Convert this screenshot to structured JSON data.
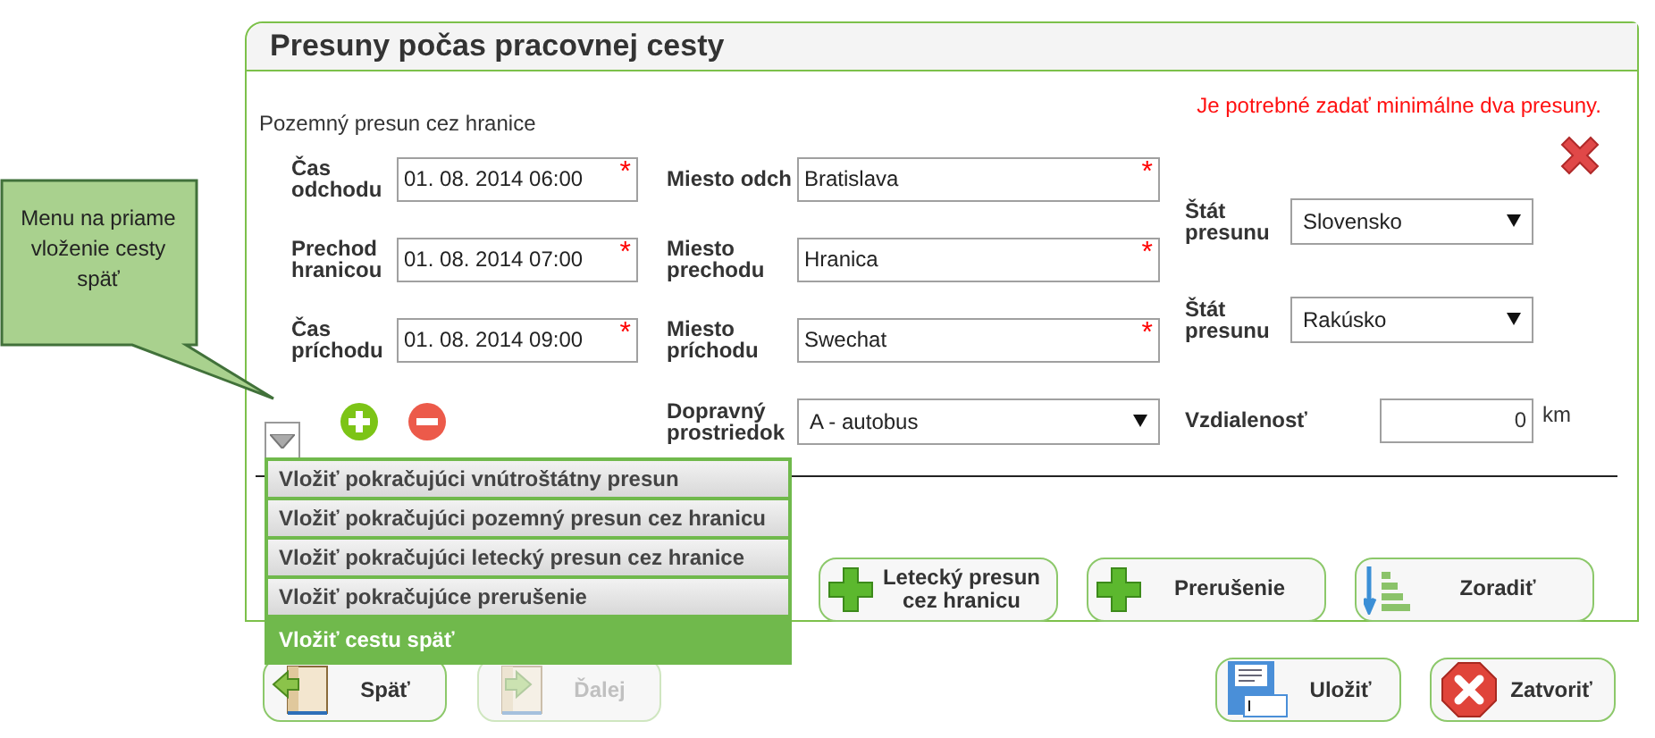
{
  "title": "Presuny počas pracovnej cesty",
  "error": "Je potrebné zadať minimálne dva presuny.",
  "section_label": "Pozemný presun cez hranice",
  "required_mark": "*",
  "times": [
    {
      "label": "Čas odchodu",
      "value": "01. 08. 2014 06:00",
      "required": true
    },
    {
      "label": "Prechod hranicou",
      "value": "01. 08. 2014 07:00",
      "required": true
    },
    {
      "label": "Čas príchodu",
      "value": "01. 08. 2014 09:00",
      "required": true
    }
  ],
  "places": [
    {
      "label": "Miesto odch",
      "value": "Bratislava",
      "required": true
    },
    {
      "label": "Miesto prechodu",
      "value": "Hranica",
      "required": true
    },
    {
      "label": "Miesto príchodu",
      "value": "Swechat",
      "required": true
    }
  ],
  "transport": {
    "label": "Dopravný prostriedok",
    "value": "A - autobus"
  },
  "states": [
    {
      "label": "Štát presunu",
      "value": "Slovensko"
    },
    {
      "label": "Štát presunu",
      "value": "Rakúsko"
    }
  ],
  "distance": {
    "label": "Vzdialenosť",
    "value": "0",
    "unit": "km"
  },
  "add_buttons": [
    {
      "label": "Letecký presun cez hranicu",
      "kind": "add"
    },
    {
      "label": "Prerušenie",
      "kind": "add"
    },
    {
      "label": "Zoradiť",
      "kind": "sort"
    }
  ],
  "menu": [
    {
      "label": "Vložiť pokračujúci vnútroštátny presun",
      "selected": false
    },
    {
      "label": "Vložiť pokračujúci pozemný presun cez hranicu",
      "selected": false
    },
    {
      "label": "Vložiť pokračujúci letecký presun cez hranice",
      "selected": false
    },
    {
      "label": "Vložiť pokračujúce prerušenie",
      "selected": false
    },
    {
      "label": "Vložiť cestu späť",
      "selected": true
    }
  ],
  "nav_buttons": [
    {
      "label": "Späť",
      "kind": "back",
      "disabled": false
    },
    {
      "label": "Ďalej",
      "kind": "next",
      "disabled": true
    }
  ],
  "footer_buttons": [
    {
      "label": "Uložiť",
      "kind": "save"
    },
    {
      "label": "Zatvoriť",
      "kind": "close"
    }
  ],
  "callout": {
    "text": "Menu na priame vloženie cesty späť"
  }
}
